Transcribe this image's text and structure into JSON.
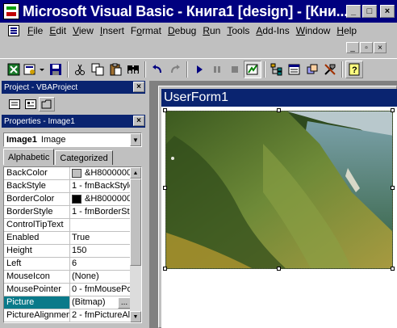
{
  "title_bar": {
    "title": "Microsoft Visual Basic - Книга1 [design] - [Кни...",
    "minimize_glyph": "_",
    "maximize_glyph": "□",
    "close_glyph": "×"
  },
  "menu": {
    "items": [
      {
        "underline": "F",
        "rest": "ile"
      },
      {
        "underline": "E",
        "rest": "dit"
      },
      {
        "underline": "V",
        "rest": "iew"
      },
      {
        "underline": "I",
        "rest": "nsert"
      },
      {
        "pre": "F",
        "underline": "o",
        "rest": "rmat"
      },
      {
        "underline": "D",
        "rest": "ebug"
      },
      {
        "underline": "R",
        "rest": "un"
      },
      {
        "underline": "T",
        "rest": "ools"
      },
      {
        "underline": "A",
        "rest": "dd-Ins"
      },
      {
        "underline": "W",
        "rest": "indow"
      },
      {
        "underline": "H",
        "rest": "elp"
      }
    ],
    "mdi_minimize": "_",
    "mdi_restore": "▫",
    "mdi_close": "×"
  },
  "toolbar": {
    "icons": [
      "excel-icon",
      "insert-userform-icon",
      "save-icon",
      "cut-icon",
      "copy-icon",
      "paste-icon",
      "find-icon",
      "undo-icon",
      "redo-icon",
      "run-icon",
      "break-icon",
      "reset-icon",
      "design-mode-icon",
      "project-explorer-icon",
      "properties-window-icon",
      "object-browser-icon",
      "toolbox-icon",
      "help-icon"
    ]
  },
  "project_pane": {
    "title": "Project - VBAProject",
    "close_glyph": "×"
  },
  "properties_pane": {
    "title": "Properties - Image1",
    "close_glyph": "×",
    "object_name": "Image1",
    "object_type": "Image",
    "tabs": [
      "Alphabetic",
      "Categorized"
    ],
    "active_tab": "Alphabetic",
    "rows": [
      {
        "name": "BackColor",
        "value": "&H8000000",
        "swatch": "#c0c0c0"
      },
      {
        "name": "BackStyle",
        "value": "1 - fmBackStyle"
      },
      {
        "name": "BorderColor",
        "value": "&H8000000",
        "swatch": "#000000"
      },
      {
        "name": "BorderStyle",
        "value": "1 - fmBorderSt"
      },
      {
        "name": "ControlTipText",
        "value": ""
      },
      {
        "name": "Enabled",
        "value": "True"
      },
      {
        "name": "Height",
        "value": "150"
      },
      {
        "name": "Left",
        "value": "6"
      },
      {
        "name": "MouseIcon",
        "value": "(None)"
      },
      {
        "name": "MousePointer",
        "value": "0 - fmMousePo"
      },
      {
        "name": "Picture",
        "value": "(Bitmap)",
        "selected": true,
        "ellipsis": "..."
      },
      {
        "name": "PictureAlignment",
        "value": "2 - fmPictureAl"
      }
    ]
  },
  "userform": {
    "caption": "UserForm1"
  },
  "colors": {
    "title_bar": "#00007f",
    "pane_title": "#0a2470",
    "selected_property": "#0a7a8a",
    "face": "#c0c0c0"
  }
}
